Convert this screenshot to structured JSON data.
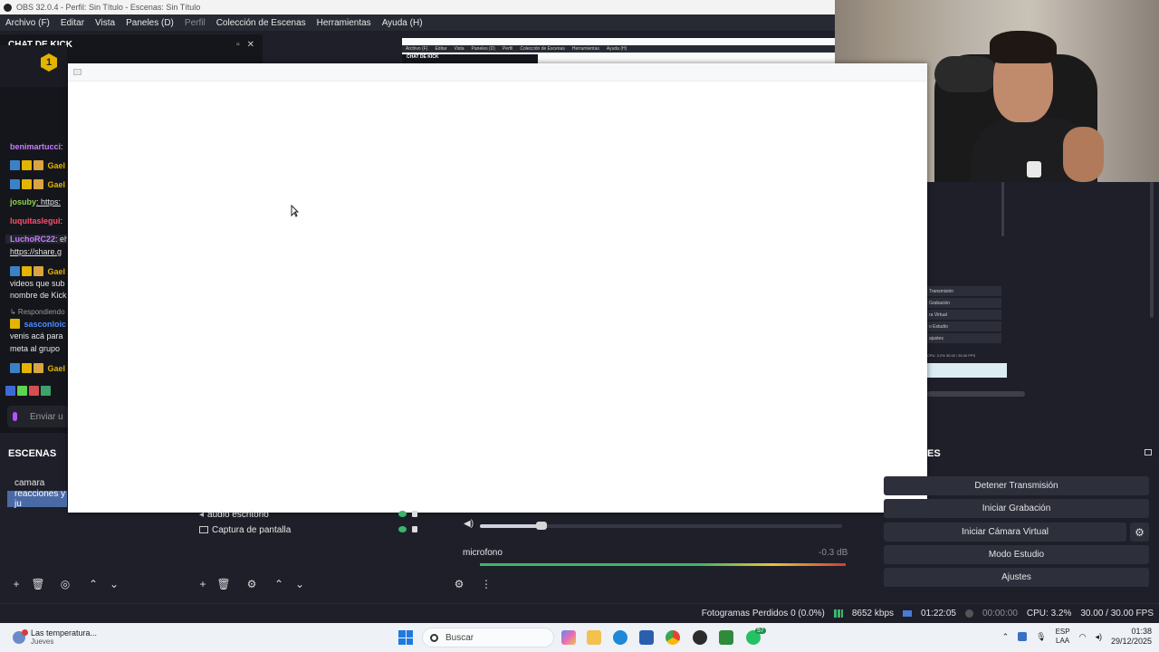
{
  "window": {
    "title": "OBS 32.0.4 - Perfil: Sin Título - Escenas: Sin Título"
  },
  "menu": [
    {
      "label": "Archivo (F)",
      "enabled": true
    },
    {
      "label": "Editar",
      "enabled": true
    },
    {
      "label": "Vista",
      "enabled": true
    },
    {
      "label": "Paneles (D)",
      "enabled": true
    },
    {
      "label": "Perfil",
      "enabled": false
    },
    {
      "label": "Colección de Escenas",
      "enabled": true
    },
    {
      "label": "Herramientas",
      "enabled": true
    },
    {
      "label": "Ayuda (H)",
      "enabled": true
    }
  ],
  "mini_menu": [
    "Archivo (F)",
    "Editar",
    "Vista",
    "Paneles (D)",
    "Perfil",
    "Colección de Escenas",
    "Herramientas",
    "Ayuda (H)"
  ],
  "chat": {
    "title": "CHAT DE KICK",
    "badge": "1",
    "mini_title": "CHAT DE KICK",
    "lines": [
      {
        "user": "benimartucci",
        "text": ":",
        "color": "#c77dff"
      },
      {
        "user": "Gael",
        "text": "",
        "color": "#e3b400"
      },
      {
        "user": "Gael",
        "text": "",
        "color": "#e3b400"
      },
      {
        "user": "josuby",
        "text": ": https:",
        "color": "#8bd34b"
      },
      {
        "user": "luquitaslegui",
        "text": ":",
        "color": "#ff4d6d"
      },
      {
        "user": "LuchoRC22",
        "text": ": eh",
        "color": "#c77dff"
      },
      {
        "user": "",
        "text": "https://share.g",
        "color": "#e6e6e6"
      },
      {
        "user": "Gael",
        "text": "",
        "color": "#e3b400"
      },
      {
        "user": "",
        "text": "videos que sub",
        "color": "#e6e6e6"
      },
      {
        "user": "",
        "text": "nombre de Kick",
        "color": "#e6e6e6"
      },
      {
        "user": "",
        "text": "↳ Respondiendo",
        "color": "#9a9a9a"
      },
      {
        "user": "sasconloic",
        "text": "",
        "color": "#4a8cff"
      },
      {
        "user": "",
        "text": "venis acá para",
        "color": "#e6e6e6"
      },
      {
        "user": "",
        "text": "meta al grupo",
        "color": "#e6e6e6"
      },
      {
        "user": "Gael",
        "text": "",
        "color": "#e3b400"
      }
    ],
    "input_placeholder": "Enviar u"
  },
  "scenes": {
    "title": "ESCENAS",
    "items": [
      {
        "label": "camara",
        "selected": false
      },
      {
        "label": "reacciones y ju",
        "selected": true
      }
    ]
  },
  "sources": {
    "items": [
      {
        "label": "audio escritorio",
        "icon": "speaker-icon"
      },
      {
        "label": "Captura de pantalla",
        "icon": "monitor-icon"
      }
    ]
  },
  "mixer": {
    "channel_label": "microfono",
    "channel_db": "-0.3 dB",
    "volume_level": 0.17
  },
  "controls": {
    "title": "ES",
    "stop_stream": "Detener Transmisión",
    "start_recording": "Iniciar Grabación",
    "start_virtual_cam": "Iniciar Cámara Virtual",
    "studio_mode": "Modo Estudio",
    "settings": "Ajustes"
  },
  "mini_controls": [
    "Transmisión",
    "Grabación",
    "ra Virtual",
    "o Estudio",
    "ajustes"
  ],
  "mini_status": "CPU: 3.2%  30.00 / 30.00 FPS",
  "status": {
    "dropped_frames": "Fotogramas Perdidos 0 (0.0%)",
    "bitrate": "8652 kbps",
    "stream_time": "01:22:05",
    "rec_time": "00:00:00",
    "cpu": "CPU: 3.2%",
    "fps": "30.00 / 30.00 FPS"
  },
  "taskbar": {
    "weather_title": "Las temperatura...",
    "weather_sub": "Jueves",
    "search_placeholder": "Buscar",
    "lang_top": "ESP",
    "lang_bottom": "LAA",
    "time": "01:38",
    "date": "29/12/2025",
    "whatsapp_badge": "57"
  },
  "colors": {
    "accent_selected": "#4a6aa6",
    "panel_bg": "#1e1f29",
    "meter_green": "#3cb56a"
  }
}
